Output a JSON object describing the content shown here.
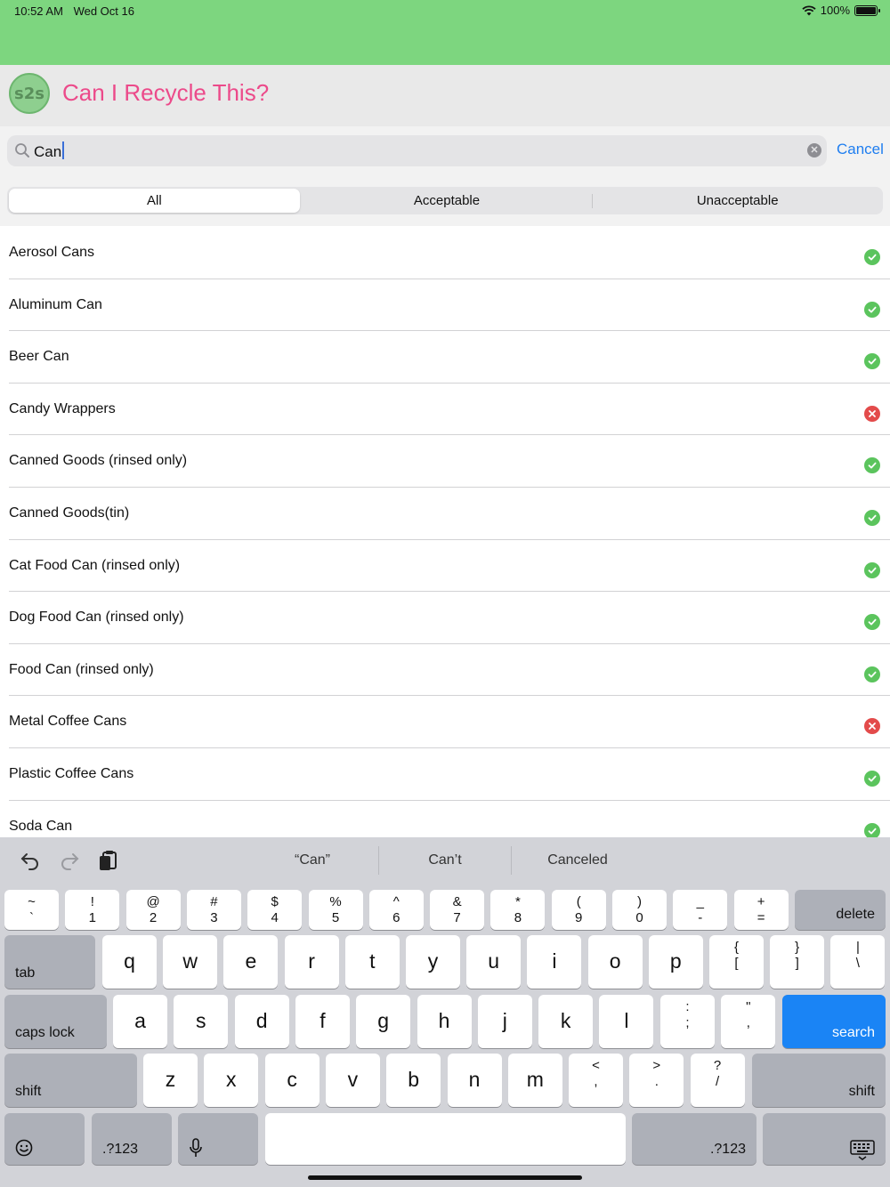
{
  "status_bar": {
    "time": "10:52 AM",
    "date": "Wed Oct 16",
    "battery": "100%"
  },
  "header": {
    "logo_text": "s2s",
    "title": "Can I Recycle This?"
  },
  "search": {
    "value": "Can",
    "cancel_label": "Cancel"
  },
  "segments": {
    "all": "All",
    "acceptable": "Acceptable",
    "unacceptable": "Unacceptable",
    "selected": "All"
  },
  "colors": {
    "accent": "#1f7ef0",
    "title": "#ec4a8a",
    "header_green": "#7dd67f",
    "ok": "#5bc45d",
    "no": "#e34b4b"
  },
  "items": [
    {
      "name": "Aerosol Cans",
      "status": "acceptable"
    },
    {
      "name": "Aluminum Can",
      "status": "acceptable"
    },
    {
      "name": "Beer Can",
      "status": "acceptable"
    },
    {
      "name": "Candy Wrappers",
      "status": "unacceptable"
    },
    {
      "name": "Canned Goods (rinsed only)",
      "status": "acceptable"
    },
    {
      "name": "Canned Goods(tin)",
      "status": "acceptable"
    },
    {
      "name": "Cat Food Can (rinsed only)",
      "status": "acceptable"
    },
    {
      "name": "Dog Food Can (rinsed only)",
      "status": "acceptable"
    },
    {
      "name": "Food Can (rinsed only)",
      "status": "acceptable"
    },
    {
      "name": "Metal Coffee Cans",
      "status": "unacceptable"
    },
    {
      "name": "Plastic Coffee Cans",
      "status": "acceptable"
    },
    {
      "name": "Soda Can",
      "status": "acceptable"
    }
  ],
  "keyboard": {
    "suggestions": [
      "“Can”",
      "Can’t",
      "Canceled"
    ],
    "row_numbers": [
      {
        "top": "~",
        "bot": "`"
      },
      {
        "top": "!",
        "bot": "1"
      },
      {
        "top": "@",
        "bot": "2"
      },
      {
        "top": "#",
        "bot": "3"
      },
      {
        "top": "$",
        "bot": "4"
      },
      {
        "top": "%",
        "bot": "5"
      },
      {
        "top": "^",
        "bot": "6"
      },
      {
        "top": "&",
        "bot": "7"
      },
      {
        "top": "*",
        "bot": "8"
      },
      {
        "top": "(",
        "bot": "9"
      },
      {
        "top": ")",
        "bot": "0"
      },
      {
        "top": "_",
        "bot": "-"
      },
      {
        "top": "+",
        "bot": "="
      }
    ],
    "row_q": [
      "q",
      "w",
      "e",
      "r",
      "t",
      "y",
      "u",
      "i",
      "o",
      "p"
    ],
    "row_q_extra": [
      {
        "top": "{",
        "bot": "["
      },
      {
        "top": "}",
        "bot": "]"
      },
      {
        "top": "|",
        "bot": "\\"
      }
    ],
    "row_a": [
      "a",
      "s",
      "d",
      "f",
      "g",
      "h",
      "j",
      "k",
      "l"
    ],
    "row_a_extra": [
      {
        "top": ":",
        "bot": ";"
      },
      {
        "top": "\"",
        "bot": ","
      }
    ],
    "row_z": [
      "z",
      "x",
      "c",
      "v",
      "b",
      "n",
      "m"
    ],
    "row_z_extra": [
      {
        "top": "<",
        "bot": ","
      },
      {
        "top": ">",
        "bot": "."
      },
      {
        "top": "?",
        "bot": "/"
      }
    ],
    "delete": "delete",
    "tab": "tab",
    "caps_lock": "caps lock",
    "search": "search",
    "shift": "shift",
    "num_switch": ".?123"
  }
}
